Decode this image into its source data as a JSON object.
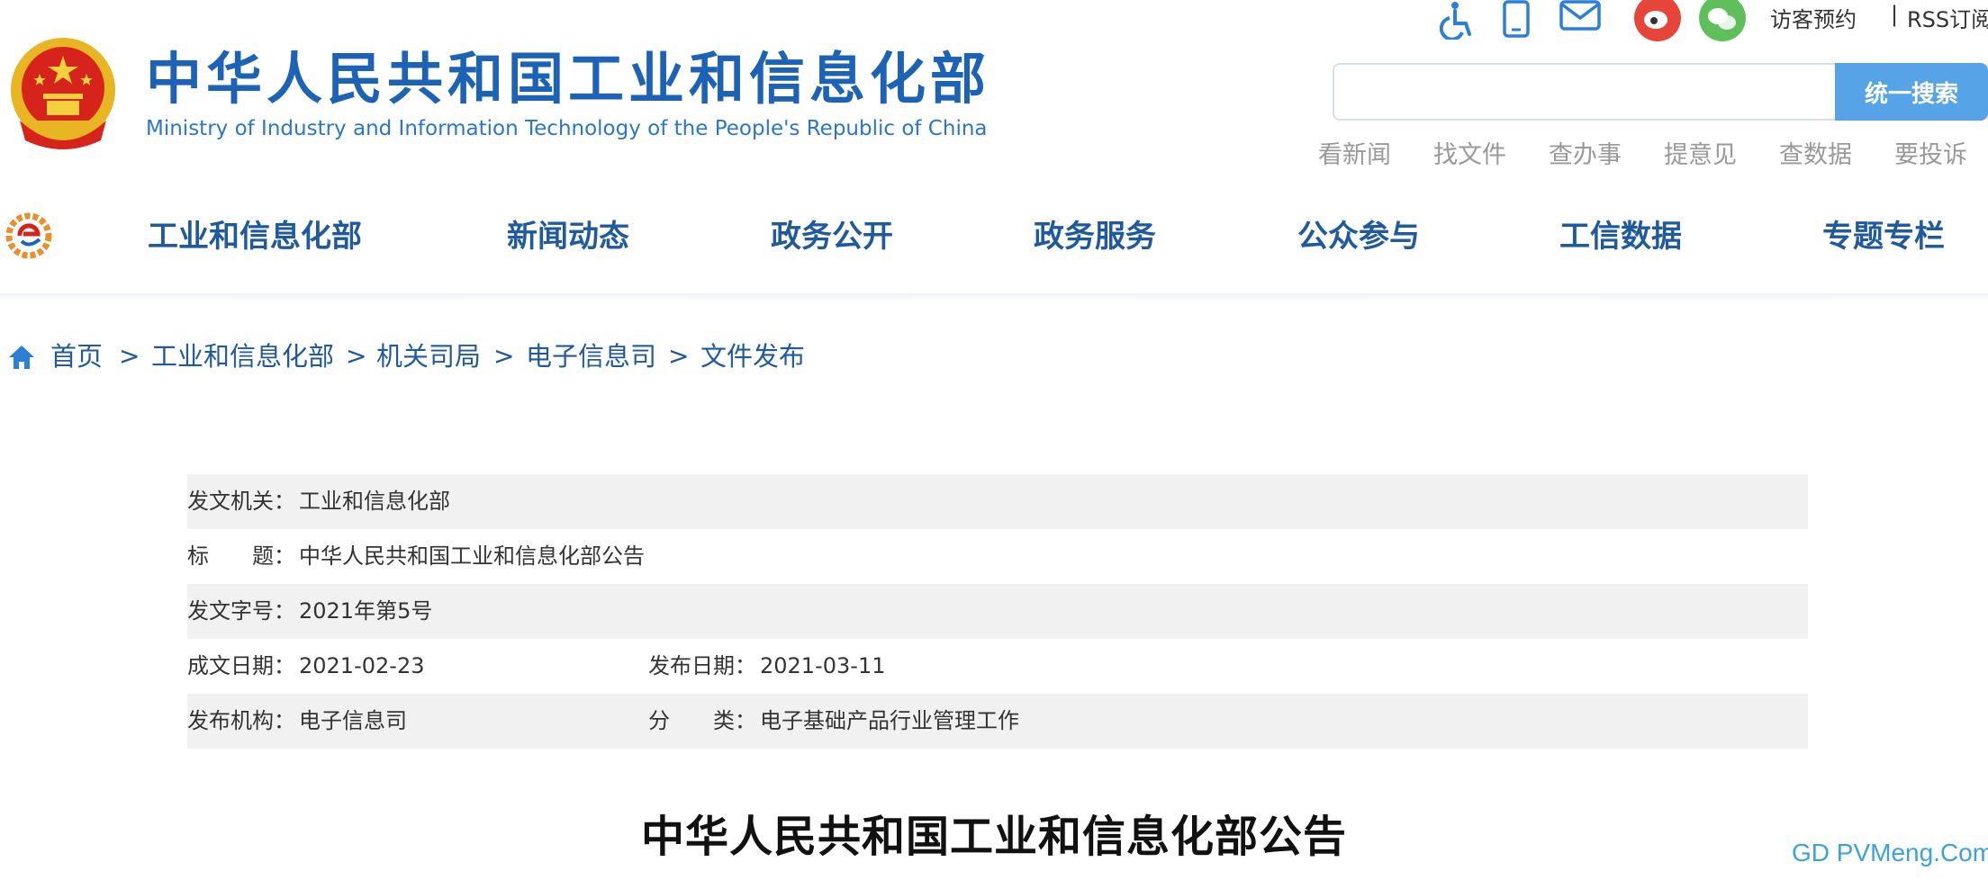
{
  "header": {
    "title": "中华人民共和国工业和信息化部",
    "subtitle": "Ministry of Industry and Information Technology of the People's Republic of China",
    "icons": [
      "accessibility-icon",
      "mobile-icon",
      "mail-icon",
      "weibo-icon",
      "wechat-icon"
    ],
    "visit_label": "访客预约",
    "separator": "|",
    "rss_label": "RSS订阅",
    "search_placeholder": "",
    "search_button": "统一搜索",
    "quick_links": [
      "看新闻",
      "找文件",
      "查办事",
      "提意见",
      "查数据",
      "要投诉"
    ]
  },
  "nav": {
    "items": [
      "工业和信息化部",
      "新闻动态",
      "政务公开",
      "政务服务",
      "公众参与",
      "工信数据",
      "专题专栏"
    ]
  },
  "breadcrumb": {
    "items": [
      "首页",
      "工业和信息化部",
      "机关司局",
      "电子信息司",
      "文件发布"
    ],
    "separator": ">"
  },
  "info": {
    "issuer_label": "发文机关：",
    "issuer": "工业和信息化部",
    "title_label": "标　　题：",
    "title": "中华人民共和国工业和信息化部公告",
    "doc_no_label": "发文字号：",
    "doc_no": "2021年第5号",
    "written_label": "成文日期：",
    "written_date": "2021-02-23",
    "publish_label": "发布日期：",
    "publish_date": "2021-03-11",
    "org_label": "发布机构：",
    "org": "电子信息司",
    "category_label": "分　　类：",
    "category": "电子基础产品行业管理工作"
  },
  "document": {
    "heading": "中华人民共和国工业和信息化部公告"
  },
  "watermark": "GD PVMeng.Com",
  "colors": {
    "brand_blue": "#1c63b7",
    "nav_blue": "#1f5a9e",
    "search_button": "#56a3e8",
    "row_gray": "#f1f1f1",
    "watermark": "#3aa3d9"
  }
}
